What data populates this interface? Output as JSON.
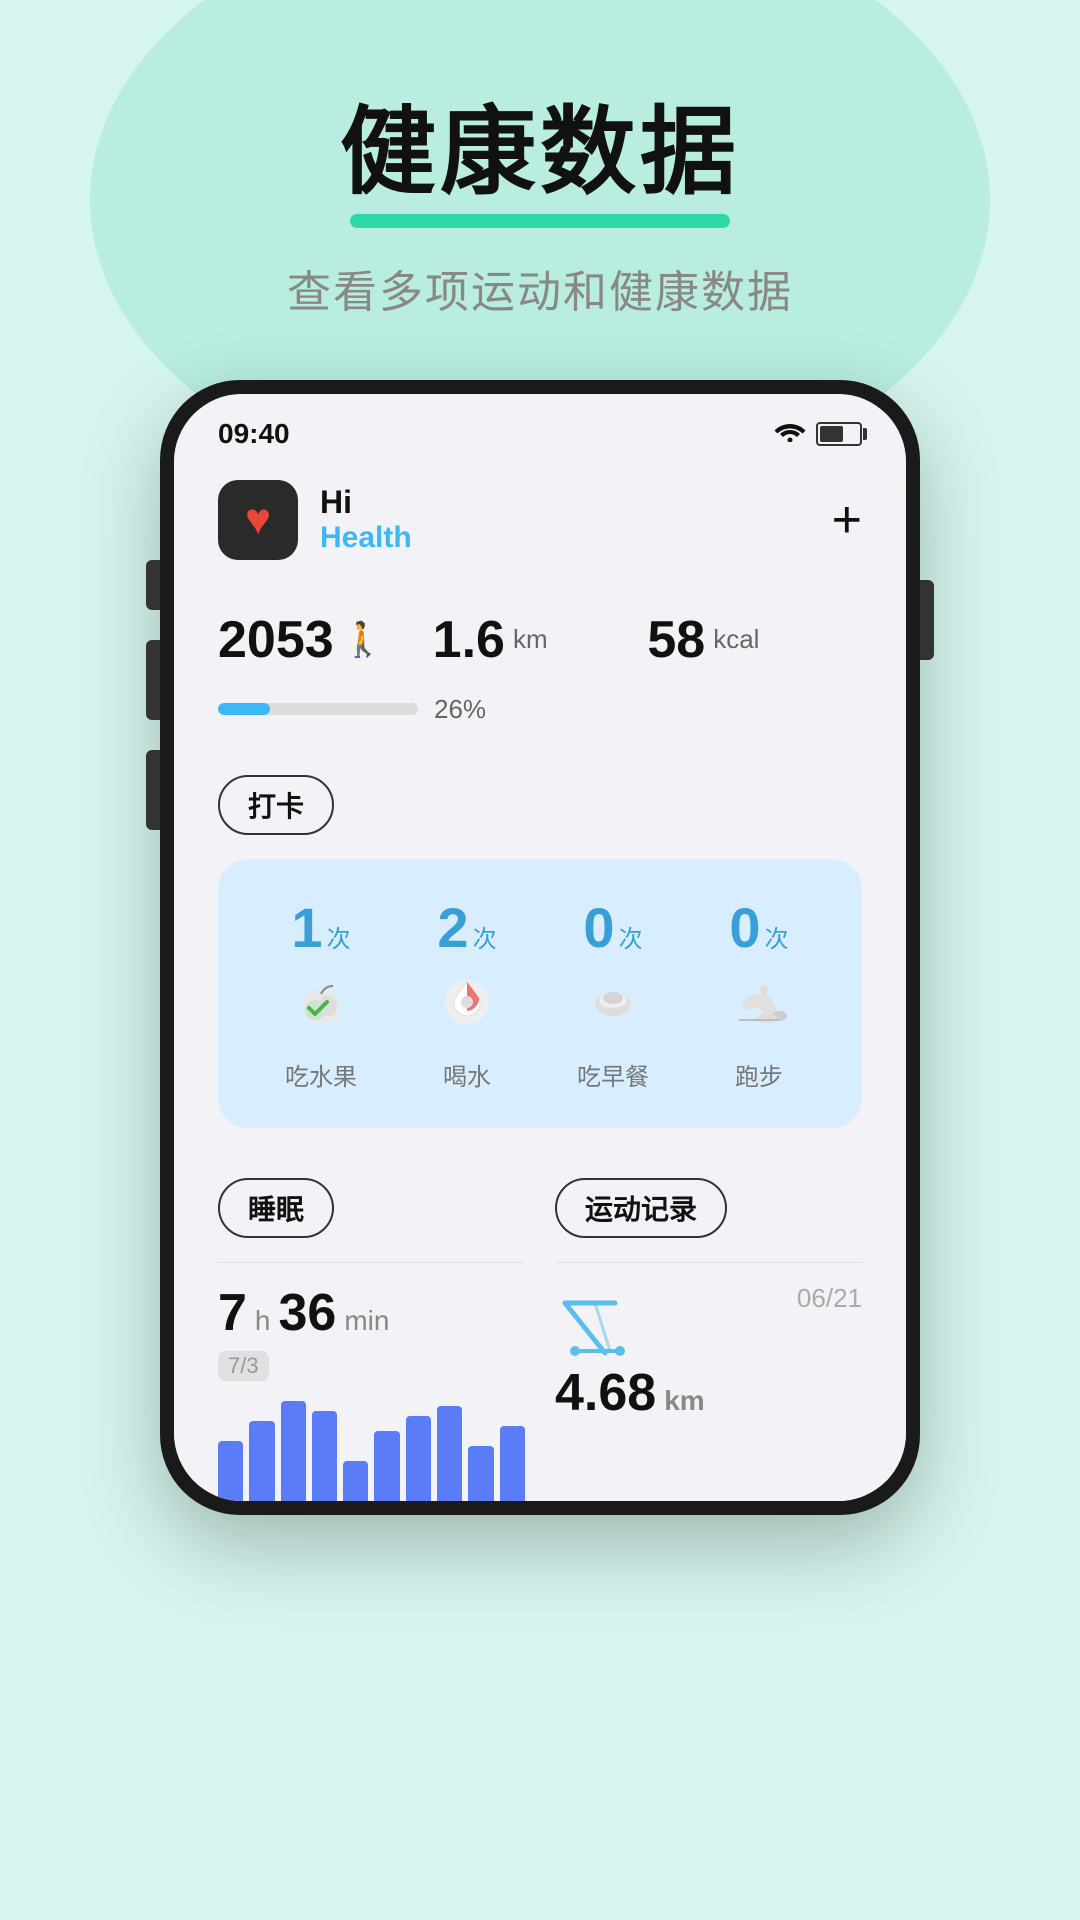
{
  "background": {
    "color": "#d6f5ee"
  },
  "header": {
    "main_title": "健康数据",
    "subtitle": "查看多项运动和健康数据"
  },
  "phone": {
    "status_bar": {
      "time": "09:40"
    },
    "app": {
      "greeting": "Hi",
      "name": "Health",
      "add_button": "+"
    },
    "stats": {
      "steps": "2053",
      "steps_unit": "",
      "distance": "1.6",
      "distance_unit": "km",
      "calories": "58",
      "calories_unit": "kcal",
      "progress_percent": "26%",
      "progress_value": 26
    },
    "checkin": {
      "tag": "打卡",
      "items": [
        {
          "count": "1",
          "unit": "次",
          "emoji": "🍎",
          "label": "吃水果"
        },
        {
          "count": "2",
          "unit": "次",
          "emoji": "🥛",
          "label": "喝水"
        },
        {
          "count": "0",
          "unit": "次",
          "emoji": "🥚",
          "label": "吃早餐"
        },
        {
          "count": "0",
          "unit": "次",
          "emoji": "👟",
          "label": "跑步"
        }
      ]
    },
    "sleep": {
      "tag": "睡眠",
      "hours": "7",
      "h_label": "h",
      "minutes": "36",
      "min_label": "min",
      "goal": "7/3",
      "bars": [
        60,
        80,
        100,
        90,
        40,
        70,
        85,
        95,
        55,
        75
      ]
    },
    "exercise": {
      "tag": "运动记录",
      "date": "06/21",
      "distance": "4.68",
      "distance_unit": "km"
    }
  }
}
